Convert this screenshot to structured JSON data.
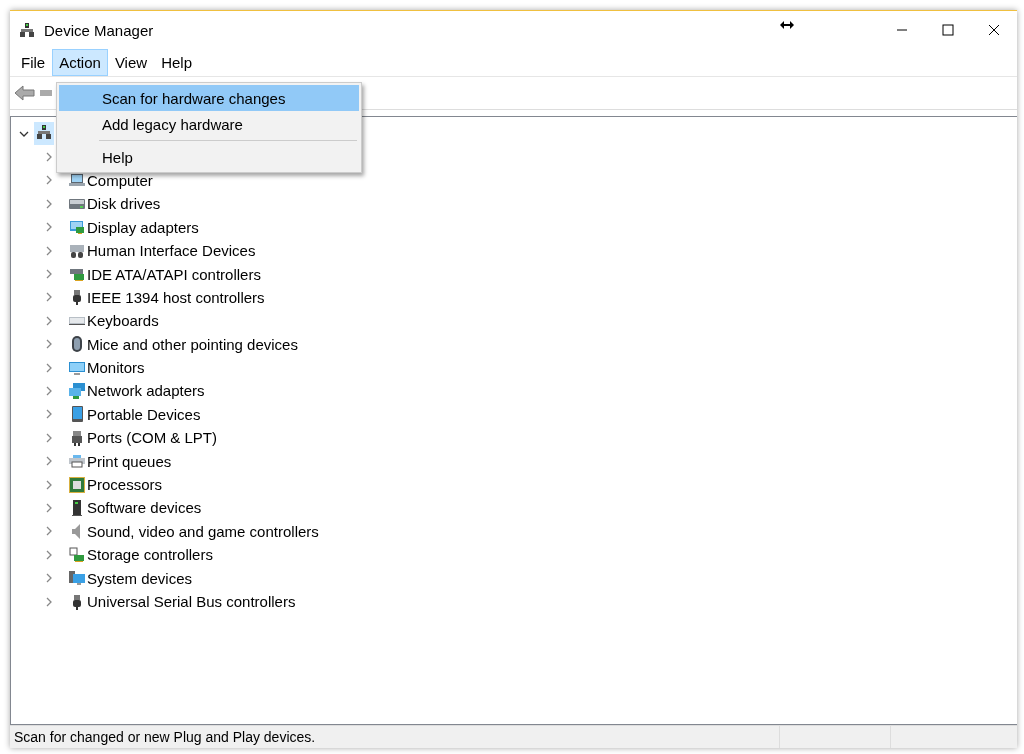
{
  "window": {
    "title": "Device Manager"
  },
  "menu_bar": [
    {
      "label": "File",
      "selected": false
    },
    {
      "label": "Action",
      "selected": true
    },
    {
      "label": "View",
      "selected": false
    },
    {
      "label": "Help",
      "selected": false
    }
  ],
  "action_menu": [
    {
      "label": "Scan for hardware changes",
      "selected": true
    },
    {
      "label": "Add legacy hardware",
      "selected": false
    },
    {
      "kind": "separator"
    },
    {
      "label": "Help",
      "selected": false
    }
  ],
  "tree": {
    "expanded": true,
    "children": [
      {
        "expanded": false
      },
      {
        "label": "Computer",
        "expanded": false,
        "kind": "computer"
      },
      {
        "label": "Disk drives",
        "expanded": false,
        "kind": "disk"
      },
      {
        "label": "Display adapters",
        "expanded": false,
        "kind": "display"
      },
      {
        "label": "Human Interface Devices",
        "expanded": false,
        "kind": "hid"
      },
      {
        "label": "IDE ATA/ATAPI controllers",
        "expanded": false,
        "kind": "card"
      },
      {
        "label": "IEEE 1394 host controllers",
        "expanded": false,
        "kind": "plug"
      },
      {
        "label": "Keyboards",
        "expanded": false,
        "kind": "keyboard"
      },
      {
        "label": "Mice and other pointing devices",
        "expanded": false,
        "kind": "mouse"
      },
      {
        "label": "Monitors",
        "expanded": false,
        "kind": "monitor"
      },
      {
        "label": "Network adapters",
        "expanded": false,
        "kind": "network"
      },
      {
        "label": "Portable Devices",
        "expanded": false,
        "kind": "portable"
      },
      {
        "label": "Ports (COM & LPT)",
        "expanded": false,
        "kind": "port"
      },
      {
        "label": "Print queues",
        "expanded": false,
        "kind": "printer"
      },
      {
        "label": "Processors",
        "expanded": false,
        "kind": "cpu"
      },
      {
        "label": "Software devices",
        "expanded": false,
        "kind": "tower"
      },
      {
        "label": "Sound, video and game controllers",
        "expanded": false,
        "kind": "speaker"
      },
      {
        "label": "Storage controllers",
        "expanded": false,
        "kind": "storage"
      },
      {
        "label": "System devices",
        "expanded": false,
        "kind": "system"
      },
      {
        "label": "Universal Serial Bus controllers",
        "expanded": false,
        "kind": "plug"
      }
    ]
  },
  "status_bar": {
    "text": "Scan for changed or new Plug and Play devices."
  }
}
